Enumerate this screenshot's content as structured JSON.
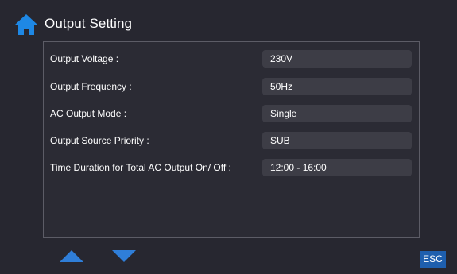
{
  "header": {
    "title": "Output Setting",
    "icon": "home-icon",
    "icon_color": "#1e88e5"
  },
  "settings": [
    {
      "label": "Output Voltage :",
      "value": "230V"
    },
    {
      "label": "Output Frequency :",
      "value": "50Hz"
    },
    {
      "label": "AC Output Mode :",
      "value": "Single"
    },
    {
      "label": "Output Source Priority :",
      "value": "SUB"
    },
    {
      "label": "Time Duration for Total AC Output On/ Off :",
      "value": "12:00 - 16:00"
    }
  ],
  "navigation": {
    "up_icon": "triangle-up-icon",
    "down_icon": "triangle-down-icon",
    "arrow_color": "#2f7ed8",
    "esc_label": "ESC",
    "esc_color": "#1e5fae"
  }
}
